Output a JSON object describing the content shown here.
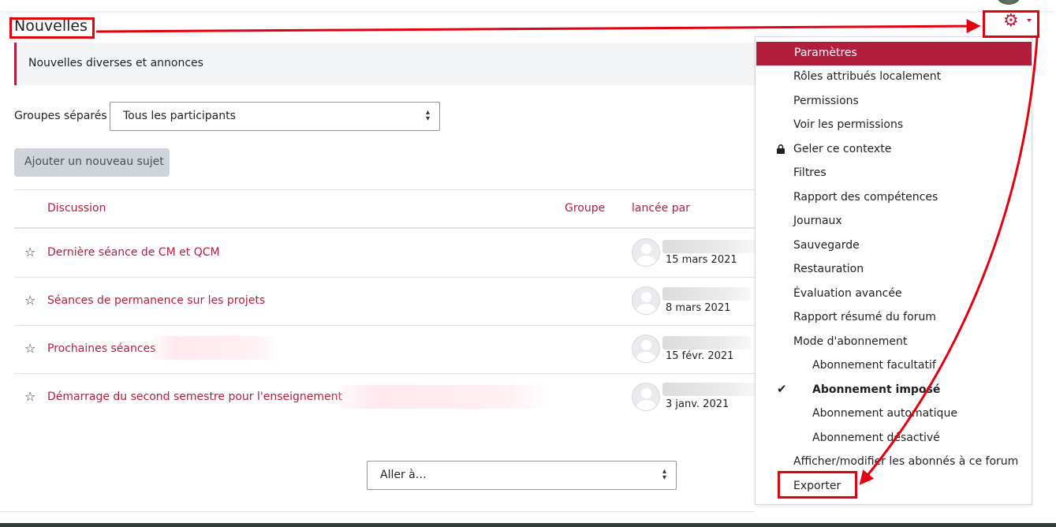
{
  "page": {
    "title": "Nouvelles",
    "intro": "Nouvelles diverses et annonces"
  },
  "groups": {
    "label": "Groupes séparés",
    "selected": "Tous les participants"
  },
  "add_button": "Ajouter un nouveau sujet",
  "table": {
    "headers": [
      "Discussion",
      "Groupe",
      "lancée par"
    ],
    "rows": [
      {
        "title": "Dernière séance de CM et QCM",
        "date": "15 mars 2021"
      },
      {
        "title": "Séances de permanence sur les projets",
        "date": "8 mars 2021"
      },
      {
        "title": "Prochaines séances",
        "date": "15 févr. 2021"
      },
      {
        "title": "Démarrage du second semestre pour l'enseignement",
        "date": "3 janv. 2021"
      }
    ]
  },
  "jump": {
    "selected": "Aller à…"
  },
  "menu": {
    "items": [
      "Paramètres",
      "Rôles attribués localement",
      "Permissions",
      "Voir les permissions",
      "Geler ce contexte",
      "Filtres",
      "Rapport des compétences",
      "Journaux",
      "Sauvegarde",
      "Restauration",
      "Évaluation avancée",
      "Rapport résumé du forum",
      "Mode d'abonnement",
      "Abonnement facultatif",
      "Abonnement imposé",
      "Abonnement automatique",
      "Abonnement désactivé",
      "Afficher/modifier les abonnés à ce forum",
      "Exporter"
    ]
  },
  "icons": {
    "gear": "gear-icon",
    "lock": "lock-icon",
    "check": "check-icon",
    "star": "star-icon"
  },
  "colors": {
    "accent": "#b21e3d",
    "annotation": "#e3000f"
  }
}
